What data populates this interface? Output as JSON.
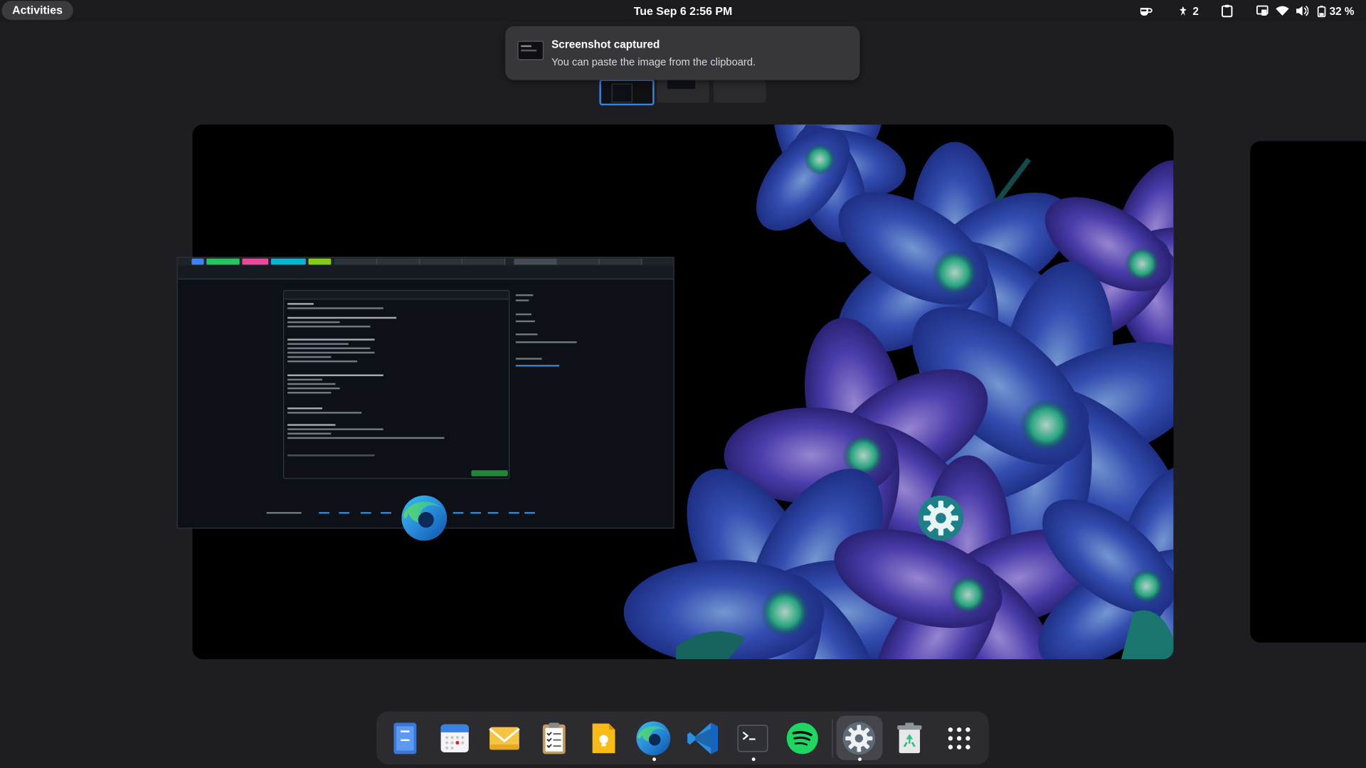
{
  "topbar": {
    "activities_label": "Activities",
    "clock_label": "Tue Sep 6   2:56 PM",
    "tray": {
      "notification_count": "2",
      "battery_label": "32 %"
    }
  },
  "notification": {
    "title": "Screenshot captured",
    "body": "You can paste the image from the clipboard."
  },
  "workspaces": {
    "count": 3,
    "active_index": 0
  },
  "overview": {
    "windows": [
      {
        "app": "Microsoft Edge",
        "icon": "edge-icon"
      },
      {
        "app": "Settings",
        "icon": "settings-gear-icon"
      }
    ]
  },
  "dock": {
    "items": [
      {
        "name": "files",
        "icon": "files-icon",
        "running": false
      },
      {
        "name": "calendar",
        "icon": "calendar-icon",
        "running": false
      },
      {
        "name": "mail",
        "icon": "mail-icon",
        "running": false
      },
      {
        "name": "tasks",
        "icon": "clipboard-checklist-icon",
        "running": false
      },
      {
        "name": "notes",
        "icon": "keep-notes-icon",
        "running": false
      },
      {
        "name": "edge",
        "icon": "edge-icon",
        "running": true
      },
      {
        "name": "vscode",
        "icon": "vscode-icon",
        "running": false
      },
      {
        "name": "terminal",
        "icon": "terminal-icon",
        "running": true
      },
      {
        "name": "spotify",
        "icon": "spotify-icon",
        "running": false
      },
      {
        "name": "settings",
        "icon": "settings-gear-icon",
        "running": true
      },
      {
        "name": "trash",
        "icon": "recycle-bin-icon",
        "running": false
      },
      {
        "name": "app-grid",
        "icon": "app-grid-icon",
        "running": false
      }
    ]
  },
  "colors": {
    "accent": "#3584e4",
    "panel": "#1b1b1e",
    "background": "#1e1e22",
    "dock": "#2b2b30"
  }
}
